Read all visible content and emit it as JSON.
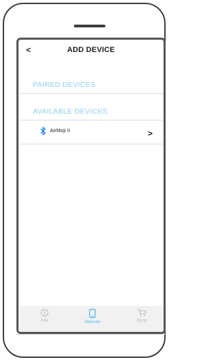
{
  "header": {
    "back_label": "<",
    "title": "ADD DEVICE"
  },
  "sections": {
    "paired": {
      "label": "PAIRED DEVICES"
    },
    "available": {
      "label": "AVAILABLE DEVICES"
    }
  },
  "devices": [
    {
      "name": "AirMoji II",
      "icon": "bluetooth-icon",
      "action": ">"
    }
  ],
  "nav": {
    "items": [
      {
        "label": "Info",
        "icon": "info-icon",
        "active": false
      },
      {
        "label": "Devices",
        "icon": "device-icon",
        "active": true
      },
      {
        "label": "Shop",
        "icon": "cart-icon",
        "active": false
      }
    ]
  },
  "colors": {
    "accent": "#47b4ea",
    "section_label": "#8ecdee",
    "bluetooth": "#1e88e5",
    "nav_inactive": "#b9b9b9"
  }
}
